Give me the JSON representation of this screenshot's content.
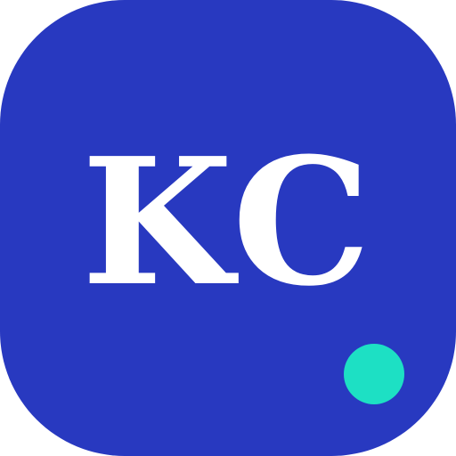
{
  "icon": {
    "monogram": "KC",
    "colors": {
      "background": "#2839c0",
      "monogram": "#ffffff",
      "status_dot": "#1de0c4"
    },
    "status_dot": "status-indicator-dot"
  }
}
